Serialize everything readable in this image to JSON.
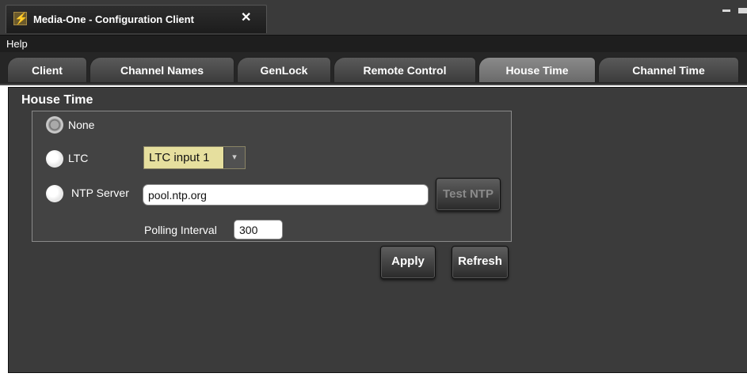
{
  "window": {
    "app_icon": "lightning-bolt-icon",
    "title": "Media-One - Configuration Client",
    "close_glyph": "✕"
  },
  "menu": {
    "help_label": "Help"
  },
  "tabs": [
    {
      "label": "Client",
      "active": false
    },
    {
      "label": "Channel Names",
      "active": false
    },
    {
      "label": "GenLock",
      "active": false
    },
    {
      "label": "Remote Control",
      "active": false
    },
    {
      "label": "House Time",
      "active": true
    },
    {
      "label": "Channel Time",
      "active": false
    }
  ],
  "house_time": {
    "group_title": "House Time",
    "options": {
      "none_label": "None",
      "ltc_label": "LTC",
      "ntp_label": "NTP Server",
      "selected": "None"
    },
    "ltc_input": {
      "selected": "LTC input 1"
    },
    "ntp_server": {
      "value": "pool.ntp.org"
    },
    "test_ntp_label": "Test NTP",
    "polling_interval_label": "Polling Interval",
    "polling_interval_value": "300"
  },
  "actions": {
    "apply_label": "Apply",
    "refresh_label": "Refresh"
  },
  "colors": {
    "panel_bg": "#3b3b3b",
    "select_bg": "#e6df9e",
    "active_tab": "#7a7a7a"
  }
}
